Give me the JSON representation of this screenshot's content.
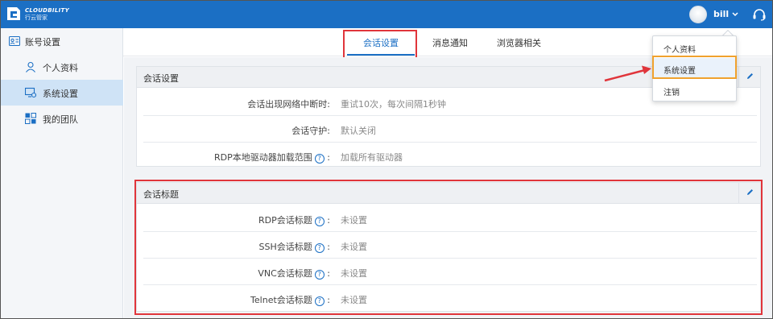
{
  "topbar": {
    "logo_text_en": "CLOUDBILITY",
    "logo_text_cn": "行云管家",
    "username": "bill",
    "caret_icon": "chevron-down-icon",
    "support_icon": "headset-icon",
    "brand_color": "#1b6fc4"
  },
  "sidebar": {
    "header": "账号设置",
    "items": [
      {
        "label": "个人资料",
        "icon": "user-icon",
        "active": false
      },
      {
        "label": "系统设置",
        "icon": "monitor-settings-icon",
        "active": true
      },
      {
        "label": "我的团队",
        "icon": "team-grid-icon",
        "active": false
      }
    ]
  },
  "tabs": [
    {
      "label": "会话设置",
      "active": true
    },
    {
      "label": "消息通知",
      "active": false
    },
    {
      "label": "浏览器相关",
      "active": false
    }
  ],
  "panels": {
    "session": {
      "title": "会话设置",
      "rows": [
        {
          "label": "会话出现网络中断时:",
          "value": "重试10次，每次间隔1秒钟",
          "help": false
        },
        {
          "label": "会话守护:",
          "value": "默认关闭",
          "help": false
        },
        {
          "label": "RDP本地驱动器加载范围",
          "value": "加载所有驱动器",
          "help": true
        }
      ]
    },
    "titles": {
      "title": "会话标题",
      "rows": [
        {
          "label": "RDP会话标题",
          "value": "未设置",
          "help": true
        },
        {
          "label": "SSH会话标题",
          "value": "未设置",
          "help": true
        },
        {
          "label": "VNC会话标题",
          "value": "未设置",
          "help": true
        },
        {
          "label": "Telnet会话标题",
          "value": "未设置",
          "help": true
        }
      ]
    }
  },
  "dropdown": {
    "items": [
      {
        "label": "个人资料"
      },
      {
        "label": "系统设置"
      },
      {
        "label": "注销"
      }
    ]
  },
  "help_glyph": "?",
  "colon": ":",
  "colors": {
    "highlight_red": "#e0353b",
    "highlight_orange": "#f0a22e",
    "active_sidebar_bg": "#cfe3f6"
  }
}
